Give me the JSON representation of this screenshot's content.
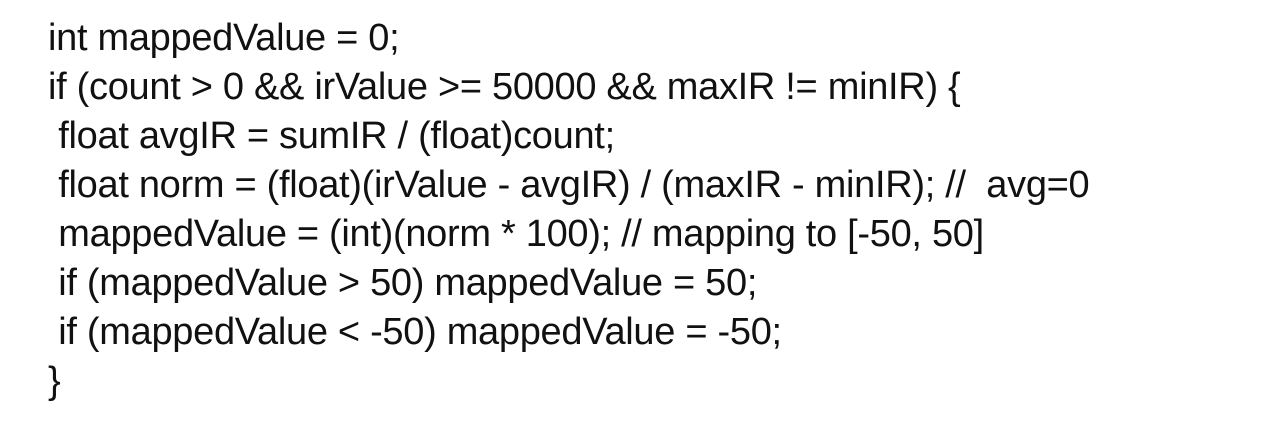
{
  "code": {
    "lines": [
      "int mappedValue = 0;",
      "if (count > 0 && irValue >= 50000 && maxIR != minIR) {",
      " float avgIR = sumIR / (float)count;",
      " float norm = (float)(irValue - avgIR) / (maxIR - minIR); //  avg=0",
      " mappedValue = (int)(norm * 100); // mapping to [-50, 50]",
      " if (mappedValue > 50) mappedValue = 50;",
      " if (mappedValue < -50) mappedValue = -50;",
      "}"
    ]
  }
}
